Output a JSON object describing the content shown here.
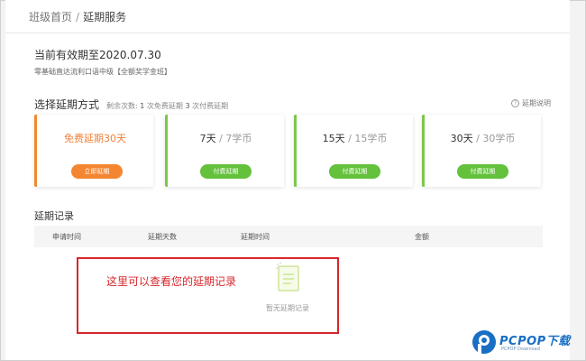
{
  "breadcrumb": {
    "home": "班级首页",
    "separator": "/",
    "current": "延期服务"
  },
  "validity": "当前有效期至2020.07.30",
  "course": "零基础直达流利口语中级【全额奖学金班】",
  "extension": {
    "title": "选择延期方式",
    "remaining_label": "剩余次数:",
    "free_count": "1",
    "free_text": "次免费延期",
    "paid_count": "3",
    "paid_text": "次付费延期",
    "help": "延期说明",
    "options": [
      {
        "title": "免费延期30天",
        "unit": "",
        "button": "立即延期",
        "accent": "#f08a2c"
      },
      {
        "title": "7天",
        "unit": "/ 7学币",
        "button": "付费延期",
        "accent": "#7ac84a"
      },
      {
        "title": "15天",
        "unit": "/ 15学币",
        "button": "付费延期",
        "accent": "#7ac84a"
      },
      {
        "title": "30天",
        "unit": "/ 30学币",
        "button": "付费延期",
        "accent": "#7ac84a"
      }
    ]
  },
  "records": {
    "title": "延期记录",
    "columns": [
      "申请时间",
      "延期天数",
      "延期时间",
      "金额"
    ],
    "empty": "暂无延期记录"
  },
  "annotation": "这里可以查看您的延期记录",
  "watermark": {
    "brand": "PCPOP下载",
    "sub": "PCPOP Download"
  },
  "colors": {
    "orange": "#f58631",
    "green": "#63c13b",
    "annotation_red": "#d8262b",
    "watermark_blue": "#1a6fc4"
  }
}
